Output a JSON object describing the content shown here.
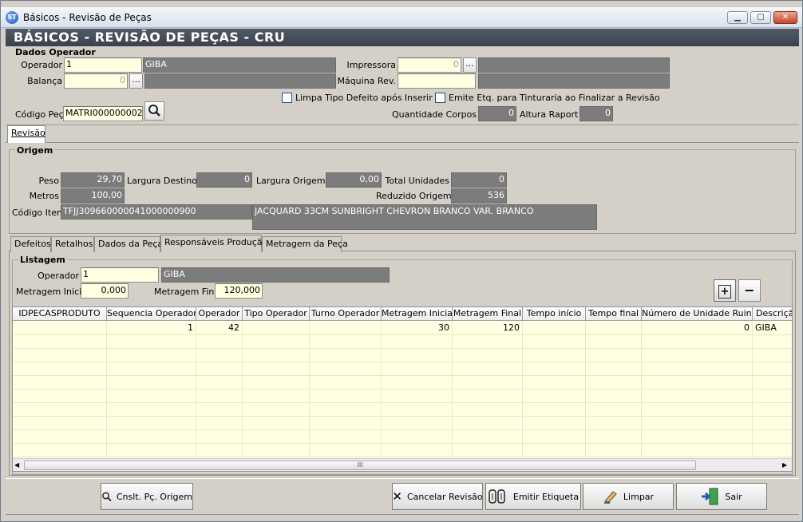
{
  "window": {
    "title": "Básicos - Revisão de Peças",
    "icon": "app-logo-icon",
    "icon_text": "ST"
  },
  "header": {
    "title": "BÁSICOS - REVISÃO DE PEÇAS - CRU"
  },
  "dados_operador": {
    "group_title": "Dados Operador",
    "operador_label": "Operador",
    "operador_value": "1",
    "operador_name": "GIBA",
    "balanca_label": "Balança",
    "balanca_value": "0",
    "balanca_btn": "...",
    "impressora_label": "Impressora",
    "impressora_value": "0",
    "impressora_btn": "...",
    "maquina_label": "Máquina Rev.",
    "limpa_label": "Limpa Tipo Defeito após Inserir",
    "emite_label": "Emite Etq. para Tinturaria  ao Finalizar a Revisão",
    "codigo_peca_label": "Código Peça",
    "codigo_peca_value": "MATRI000000002",
    "qtd_corpos_label": "Quantidade Corpos",
    "qtd_corpos_value": "0",
    "altura_raport_label": "Altura Raport",
    "altura_raport_value": "0"
  },
  "main_tab": {
    "label": "Revisão"
  },
  "origem": {
    "group_title": "Origem",
    "peso_label": "Peso",
    "peso_value": "29,70",
    "largura_destino_label": "Largura Destino",
    "largura_destino_value": "0",
    "largura_origem_label": "Largura Origem",
    "largura_origem_value": "0,00",
    "total_unidades_label": "Total Unidades",
    "total_unidades_value": "0",
    "metros_label": "Metros",
    "metros_value": "100,00",
    "reduzido_label": "Reduzido Origem",
    "reduzido_value": "536",
    "codigo_item_label": "Código Item",
    "codigo_item_value": "TFJJ309660000041000000900",
    "descricao_value": "JACQUARD 33CM  SUNBRIGHT CHEVRON BRANCO VAR. BRANCO"
  },
  "sub_tabs": [
    "Defeitos",
    "Retalhos",
    "Dados da Peça",
    "Responsáveis Produção",
    "Metragem da Peça"
  ],
  "listagem": {
    "group_title": "Listagem",
    "operador_label": "Operador",
    "operador_value": "1",
    "operador_name": "GIBA",
    "metragem_inicial_label": "Metragem Inicial",
    "metragem_inicial_value": "0,000",
    "metragem_final_label": "Metragem Final",
    "metragem_final_value": "120,000",
    "add_btn": "+",
    "remove_btn": "−"
  },
  "grid": {
    "columns": [
      "IDPECASPRODUTO",
      "Sequencia Operador",
      "Operador",
      "Tipo Operador",
      "Turno Operador",
      "Metragem Inicial",
      "Metragem Final",
      "Tempo início",
      "Tempo final",
      "Número de Unidade Ruins",
      "Descriçã"
    ],
    "row": [
      "",
      "1",
      "42",
      "",
      "",
      "30",
      "120",
      "",
      "",
      "0",
      "GIBA"
    ],
    "scroll_grip": "III"
  },
  "footer": {
    "consultar": "Cnslt. Pç. Origem",
    "cancelar": "Cancelar Revisão",
    "emitir": "Emitir Etiqueta",
    "limpar": "Limpar",
    "sair": "Sair"
  }
}
